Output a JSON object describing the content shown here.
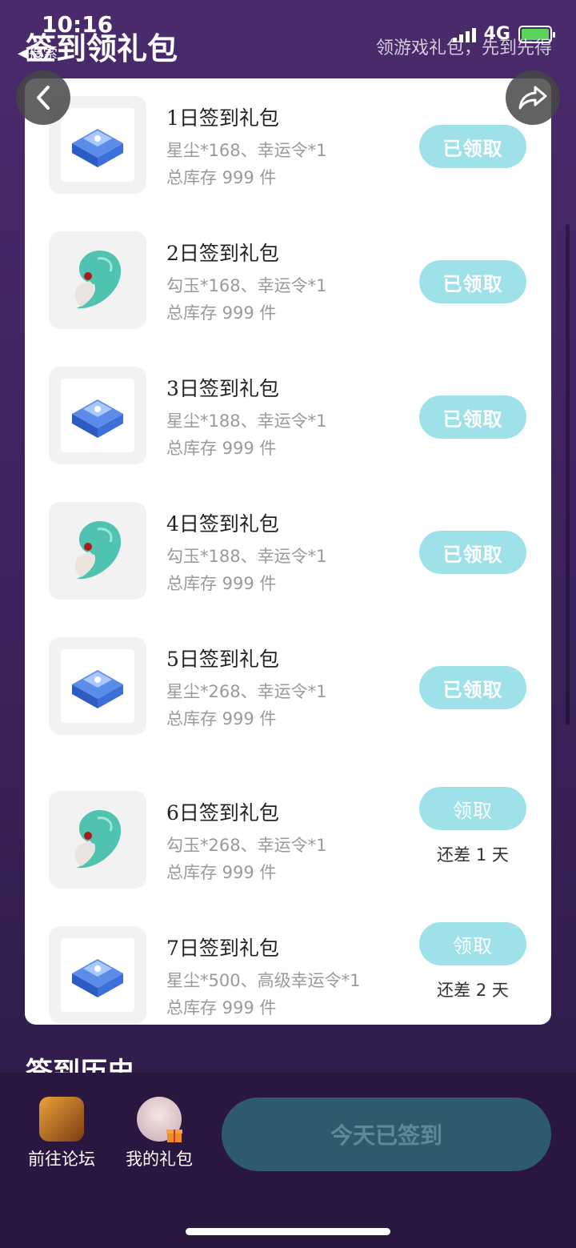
{
  "status_bar": {
    "time": "10:16",
    "back_to": "◀搜索",
    "network": "4G"
  },
  "header": {
    "title": "签到领礼包",
    "subtitle": "领游戏礼包，先到先得"
  },
  "colors": {
    "background": "#4a2a6b",
    "claim_button": "#9fe1e9",
    "checked_button": "#2f5a6b",
    "card": "#ffffff"
  },
  "gifts": [
    {
      "title": "1日签到礼包",
      "desc": "星尘*168、幸运令*1",
      "stock": "总库存 999 件",
      "button": "已领取",
      "icon": "crystal-chest-icon"
    },
    {
      "title": "2日签到礼包",
      "desc": "勾玉*168、幸运令*1",
      "stock": "总库存 999 件",
      "button": "已领取",
      "icon": "jade-magatama-icon"
    },
    {
      "title": "3日签到礼包",
      "desc": "星尘*188、幸运令*1",
      "stock": "总库存 999 件",
      "button": "已领取",
      "icon": "crystal-chest-icon"
    },
    {
      "title": "4日签到礼包",
      "desc": "勾玉*188、幸运令*1",
      "stock": "总库存 999 件",
      "button": "已领取",
      "icon": "jade-magatama-icon"
    },
    {
      "title": "5日签到礼包",
      "desc": "星尘*268、幸运令*1",
      "stock": "总库存 999 件",
      "button": "已领取",
      "icon": "crystal-chest-icon"
    },
    {
      "title": "6日签到礼包",
      "desc": "勾玉*268、幸运令*1",
      "stock": "总库存 999 件",
      "button": "领取",
      "remain": "还差 1 天",
      "icon": "jade-magatama-icon"
    },
    {
      "title": "7日签到礼包",
      "desc": "星尘*500、高级幸运令*1",
      "stock": "总库存 999 件",
      "button": "领取",
      "remain": "还差 2 天",
      "icon": "crystal-chest-icon"
    }
  ],
  "history": {
    "title": "签到历史"
  },
  "bottom_bar": {
    "forum_label": "前往论坛",
    "my_gifts_label": "我的礼包",
    "checked_in_label": "今天已签到"
  }
}
